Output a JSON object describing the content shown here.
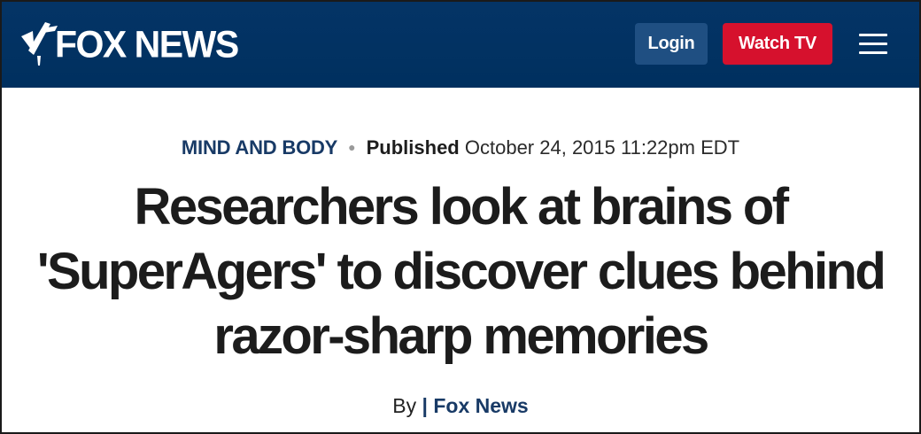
{
  "header": {
    "logo_text": "FOX NEWS",
    "login_label": "Login",
    "watch_label": "Watch TV",
    "menu_icon": "hamburger-menu-icon",
    "colors": {
      "navbar": "#003366",
      "login_button": "#1f4f82",
      "watch_button": "#d6112d"
    }
  },
  "article": {
    "category": "MIND AND BODY",
    "published_label": "Published",
    "published_date": "October 24, 2015 11:22pm EDT",
    "headline": "Researchers look at brains of 'SuperAgers' to discover clues behind razor-sharp memories",
    "byline_prefix": "By",
    "byline_separator": "|",
    "byline_source": "Fox News"
  }
}
